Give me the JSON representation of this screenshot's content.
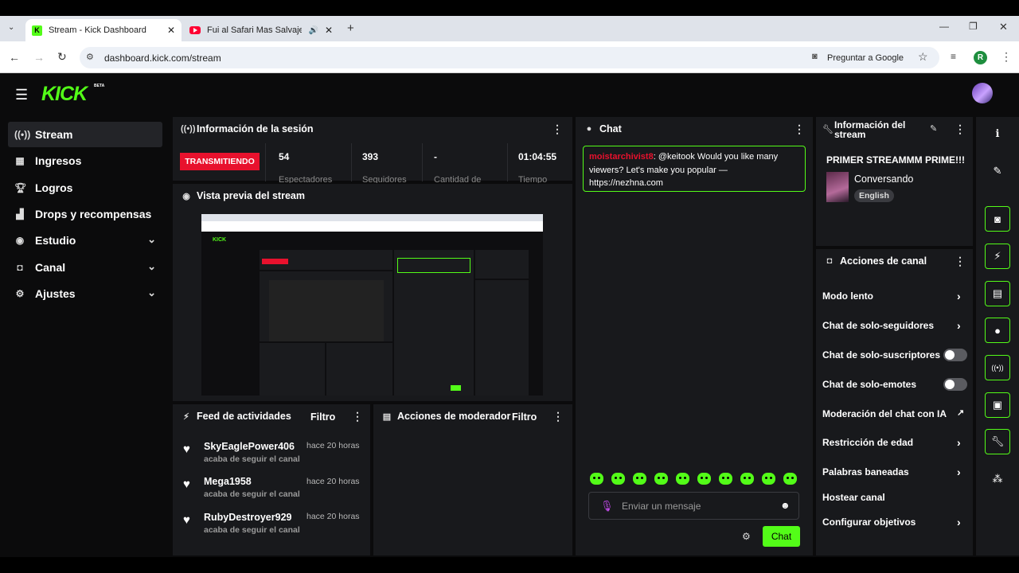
{
  "browser": {
    "tabs": [
      {
        "title": "Stream - Kick Dashboard",
        "active": true
      },
      {
        "title": "Fui al Safari Mas Salvaje de",
        "active": false
      }
    ],
    "new_tab_icon": "plus-icon",
    "url": "dashboard.kick.com/stream",
    "ask_google": "Preguntar a Google",
    "profile_initial": "R"
  },
  "app": {
    "logo": "KICK",
    "logo_badge": "BETA"
  },
  "sidebar": {
    "items": [
      {
        "label": "Stream",
        "icon": "broadcast-icon",
        "active": true
      },
      {
        "label": "Ingresos",
        "icon": "chart-icon"
      },
      {
        "label": "Logros",
        "icon": "trophy-icon"
      },
      {
        "label": "Drops y recompensas",
        "icon": "gift-icon"
      },
      {
        "label": "Estudio",
        "icon": "camera-icon",
        "expandable": true
      },
      {
        "label": "Canal",
        "icon": "users-icon",
        "expandable": true
      },
      {
        "label": "Ajustes",
        "icon": "gear-icon",
        "expandable": true
      }
    ]
  },
  "session": {
    "title": "Información de la sesión",
    "status": "TRANSMITIENDO",
    "stats": [
      {
        "value": "54",
        "label": "Espectadores"
      },
      {
        "value": "393",
        "label": "Seguidores"
      },
      {
        "value": "-",
        "label": "Cantidad de"
      },
      {
        "value": "01:04:55",
        "label": "Tiempo"
      }
    ]
  },
  "preview": {
    "title": "Vista previa del stream"
  },
  "feed": {
    "title": "Feed de actividades",
    "filter": "Filtro",
    "items": [
      {
        "name": "SkyEaglePower406",
        "time": "hace 20 horas",
        "desc": "acaba de seguir el canal"
      },
      {
        "name": "Mega1958",
        "time": "hace 20 horas",
        "desc": "acaba de seguir el canal"
      },
      {
        "name": "RubyDestroyer929",
        "time": "hace 20 horas",
        "desc": "acaba de seguir el canal"
      }
    ]
  },
  "mod": {
    "title": "Acciones de moderador",
    "filter": "Filtro"
  },
  "chat": {
    "title": "Chat",
    "message": {
      "user": "moistarchivist8",
      "text": ": @keitook Would you like many viewers? Let's make you popular — https://nezhna.com"
    },
    "placeholder": "Enviar un mensaje",
    "send": "Chat"
  },
  "stream_info": {
    "title": "Información del stream",
    "stream_title": "PRIMER STREAMMM PRIME!!!",
    "category": "Conversando",
    "language": "English"
  },
  "channel_actions": {
    "title": "Acciones de canal",
    "items": [
      {
        "label": "Modo lento",
        "control": "chevron"
      },
      {
        "label": "Chat de solo-seguidores",
        "control": "chevron"
      },
      {
        "label": "Chat de solo-suscriptores",
        "control": "toggle"
      },
      {
        "label": "Chat de solo-emotes",
        "control": "toggle"
      },
      {
        "label": "Moderación del chat con IA",
        "control": "external"
      },
      {
        "label": "Restricción de edad",
        "control": "chevron"
      },
      {
        "label": "Palabras baneadas",
        "control": "chevron"
      },
      {
        "label": "Hostear canal",
        "control": "none"
      },
      {
        "label": "Configurar objetivos",
        "control": "chevron"
      }
    ]
  },
  "colors": {
    "accent": "#53fc18",
    "live": "#e8112d",
    "panel": "#18191c",
    "bg": "#0b0b0c"
  }
}
